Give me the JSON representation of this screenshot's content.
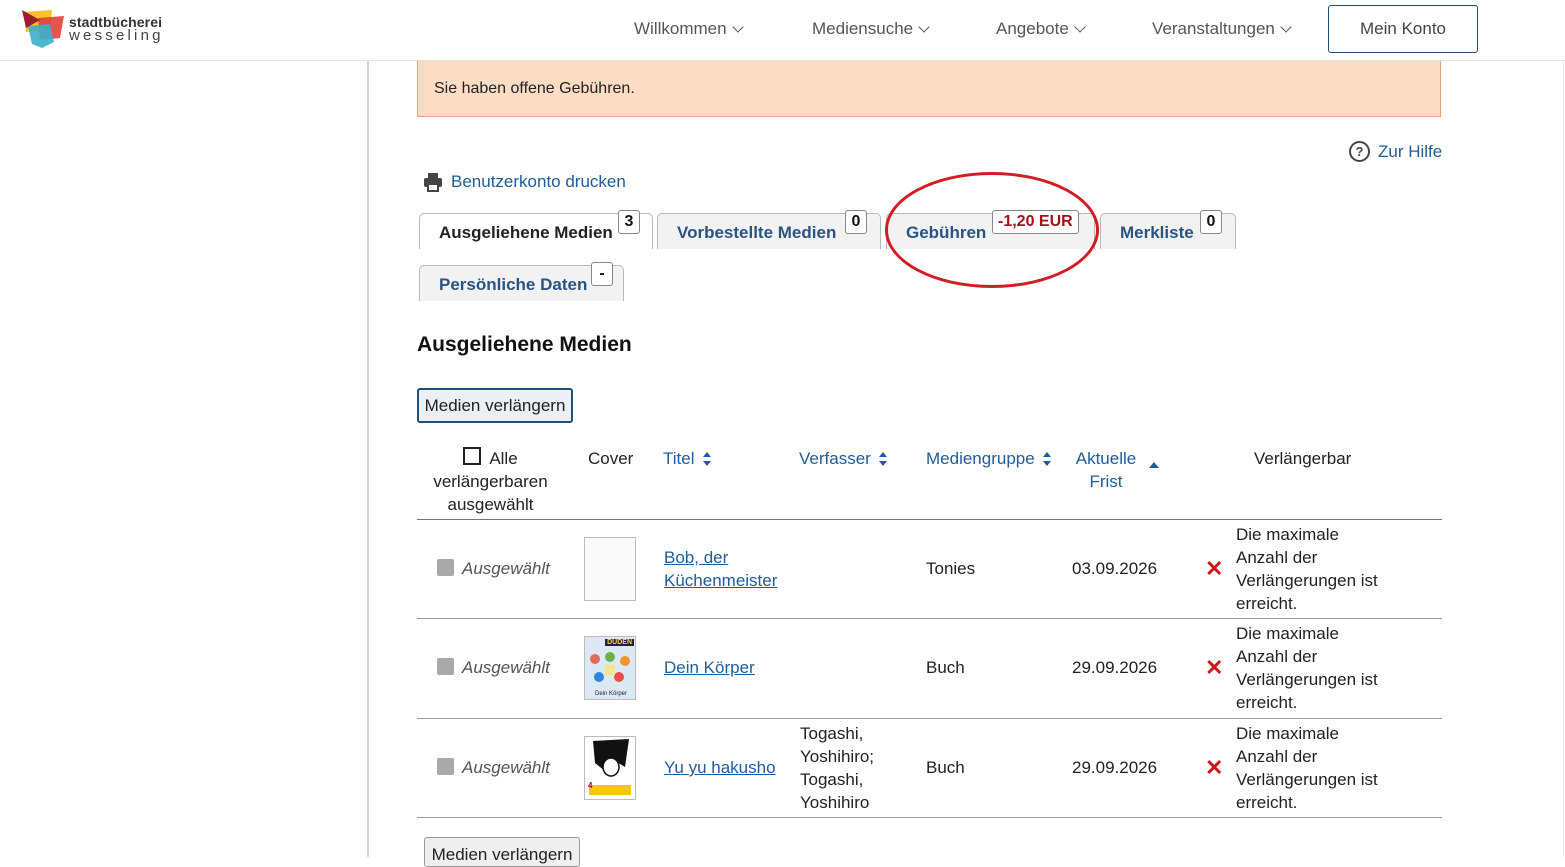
{
  "logo": {
    "line1": "stadtbücherei",
    "line2": "wesseling"
  },
  "nav": {
    "items": [
      "Willkommen",
      "Mediensuche",
      "Angebote",
      "Veranstaltungen"
    ],
    "account": "Mein Konto"
  },
  "alert": "Sie haben offene Gebühren.",
  "help": "Zur Hilfe",
  "print": "Benutzerkonto drucken",
  "tabs": [
    {
      "label": "Ausgeliehene Medien",
      "badge": "3",
      "active": true
    },
    {
      "label": "Vorbestellte Medien",
      "badge": "0"
    },
    {
      "label": "Gebühren",
      "badge": "-1,20 EUR"
    },
    {
      "label": "Merkliste",
      "badge": "0"
    },
    {
      "label": "Persönliche Daten",
      "badge": "-"
    }
  ],
  "section_title": "Ausgeliehene Medien",
  "renew_button": "Medien verlängern",
  "table": {
    "headers": {
      "select_line1": "Alle",
      "select_line2": "verlängerbaren",
      "select_line3": "ausgewählt",
      "cover": "Cover",
      "title": "Titel",
      "author": "Verfasser",
      "group": "Mediengruppe",
      "due_line1": "Aktuelle",
      "due_line2": "Frist",
      "renewable": "Verlängerbar"
    },
    "rows": [
      {
        "selected_label": "Ausgewählt",
        "title_line1": "Bob, der",
        "title_line2": "Küchenmeister",
        "author_lines": [],
        "group": "Tonies",
        "due": "03.09.2026",
        "renew_lines": [
          "Die maximale",
          "Anzahl der",
          "Verlängerungen ist",
          "erreicht."
        ]
      },
      {
        "selected_label": "Ausgewählt",
        "title_line1": "Dein Körper",
        "title_line2": "",
        "author_lines": [],
        "group": "Buch",
        "due": "29.09.2026",
        "renew_lines": [
          "Die maximale",
          "Anzahl der",
          "Verlängerungen ist",
          "erreicht."
        ]
      },
      {
        "selected_label": "Ausgewählt",
        "title_line1": "Yu yu hakusho",
        "title_line2": "",
        "author_lines": [
          "Togashi,",
          "Yoshihiro;",
          "Togashi,",
          "Yoshihiro"
        ],
        "group": "Buch",
        "due": "29.09.2026",
        "renew_lines": [
          "Die maximale",
          "Anzahl der",
          "Verlängerungen ist",
          "erreicht."
        ]
      }
    ]
  },
  "cover_texts": {
    "duden": "DUDEN",
    "dein_koerper": "Dein Körper",
    "yuyu_num": "4"
  },
  "colors": {
    "link": "#1f5d9a",
    "alert_bg": "#fcdcc3",
    "fee": "#a2121a",
    "highlight_circle": "#d31d23"
  }
}
